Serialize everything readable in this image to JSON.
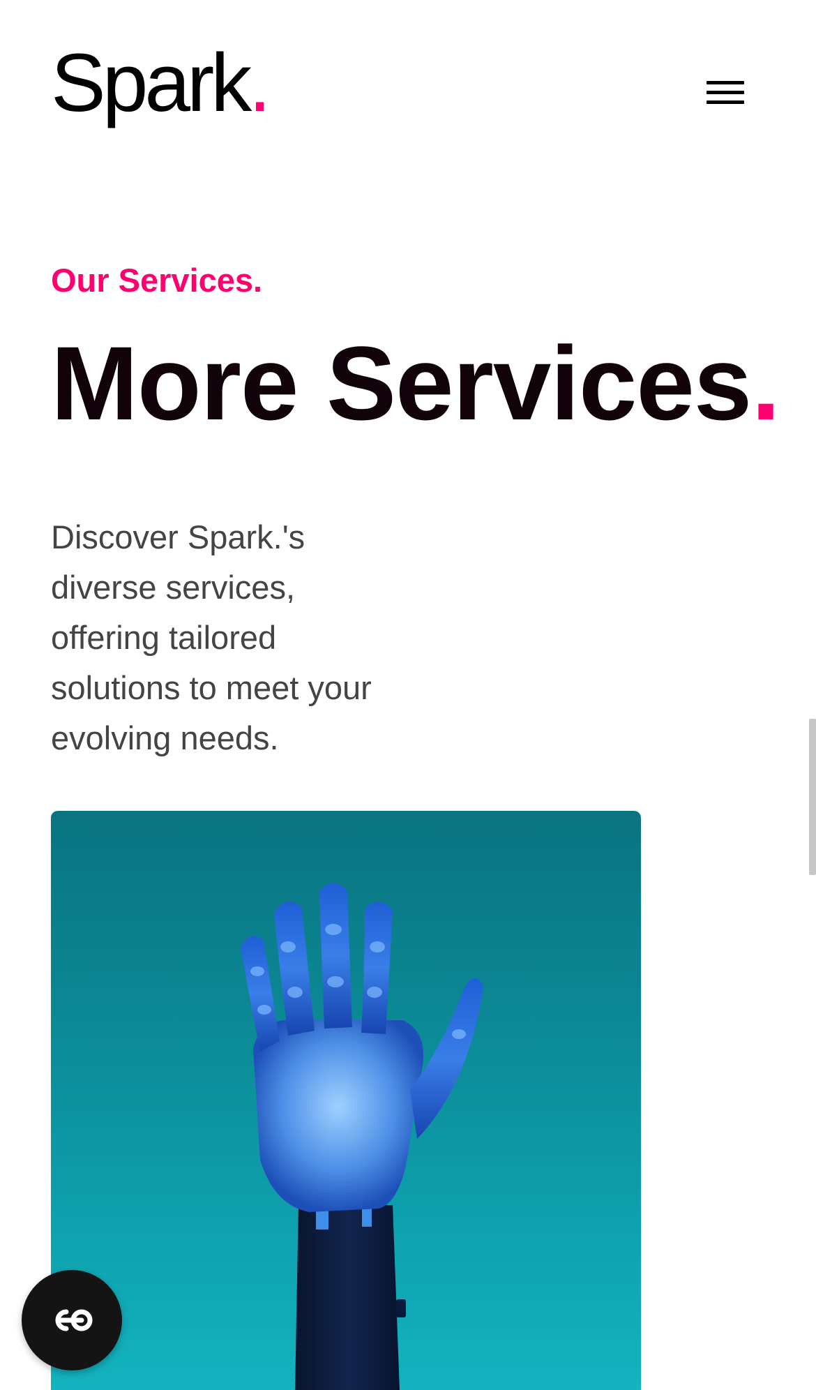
{
  "header": {
    "logo_text": "Spark",
    "logo_dot": ".",
    "menu_icon": "hamburger-menu-icon"
  },
  "services": {
    "eyebrow": "Our Services.",
    "headline": "More Services",
    "headline_dot": ".",
    "description": "Discover Spark.'s diverse services, offering tailored solutions to meet your evolving needs.",
    "image_subject": "robotic-hand-image"
  },
  "float_button": {
    "icon": "chat-loop-icon"
  },
  "colors": {
    "accent": "#ff006e",
    "heading": "#12030a",
    "body_text": "#444444",
    "image_background": "#0c8b98",
    "float_button_bg": "#141414"
  }
}
